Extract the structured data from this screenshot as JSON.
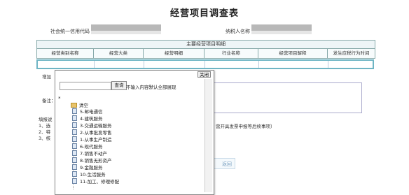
{
  "page": {
    "title": "经营项目调查表",
    "credit_code_label": "社会统一信用代码",
    "taxpayer_label": "纳税人名称",
    "table_header": "主要经营项目明细",
    "columns": [
      "经营类别名称",
      "经营大类",
      "经营明细",
      "行业名称",
      "经营项目解释",
      "发生应税行为时间"
    ]
  },
  "background": {
    "add_label": "增加",
    "remark_label": "备注：",
    "tips_label": "填报说",
    "tips_line1": "1、选",
    "tips_line2": "2、特",
    "tips_line3": "3、核",
    "note_text": "营开具发票申报等后续事项）",
    "return_label": "返回"
  },
  "popup": {
    "close_label": "关闭",
    "query_label": "查询",
    "hint": "不输入内容默认全部展现",
    "search_value": "",
    "tree_root_star": "*",
    "tree_clear": "清空",
    "tree_items": [
      "5-邮电通信",
      "4-建筑服务",
      "3-交通运输服务",
      "2-从事批发零售",
      "1-从事生产制造",
      "6-现代服务",
      "7-销售不动产",
      "8-销售无形资产",
      "9-金融服务",
      "10-生活服务",
      "11-加工、修理修配"
    ]
  }
}
